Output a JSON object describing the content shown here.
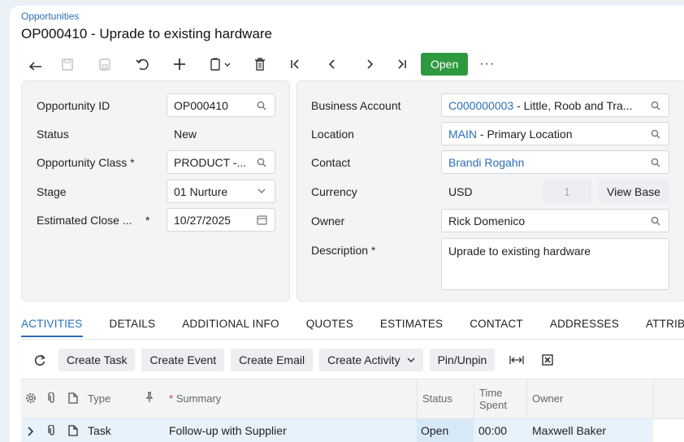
{
  "breadcrumb": "Opportunities",
  "title": "OP000410 - Uprade to existing hardware",
  "toolbar": {
    "icons": [
      "back-arrow-icon",
      "save-icon",
      "save-close-icon",
      "undo-icon",
      "add-icon",
      "copy-icon",
      "delete-icon",
      "first-icon",
      "prev-icon",
      "next-icon",
      "last-icon"
    ],
    "open_label": "Open",
    "more_label": "···"
  },
  "left": {
    "opportunity_id_label": "Opportunity ID",
    "opportunity_id": "OP000410",
    "status_label": "Status",
    "status": "New",
    "class_label": "Opportunity Class",
    "class_value": "PRODUCT -...",
    "stage_label": "Stage",
    "stage_value": "01 Nurture",
    "close_label": "Estimated Close ...",
    "close_value": "10/27/2025",
    "required_mark": "*"
  },
  "right": {
    "business_account_label": "Business Account",
    "business_account_code": "C000000003",
    "business_account_name": " - Little, Roob and Tra...",
    "location_label": "Location",
    "location_code": "MAIN",
    "location_name": " - Primary Location",
    "contact_label": "Contact",
    "contact_value": "Brandi Rogahn",
    "currency_label": "Currency",
    "currency_value": "USD",
    "rate_value": "1",
    "view_base_label": "View Base",
    "owner_label": "Owner",
    "owner_value": "Rick Domenico",
    "description_label": "Description",
    "description_value": "Uprade to existing hardware"
  },
  "tabs": [
    "ACTIVITIES",
    "DETAILS",
    "ADDITIONAL INFO",
    "QUOTES",
    "ESTIMATES",
    "CONTACT",
    "ADDRESSES",
    "ATTRIBU"
  ],
  "activity_bar": {
    "create_task": "Create Task",
    "create_event": "Create Event",
    "create_email": "Create Email",
    "create_activity": "Create Activity",
    "pin_unpin": "Pin/Unpin"
  },
  "grid": {
    "columns": {
      "type": "Type",
      "summary": "Summary",
      "status": "Status",
      "time_spent_1": "Time",
      "time_spent_2": "Spent",
      "owner": "Owner"
    },
    "rows": [
      {
        "type": "Task",
        "summary": "Follow-up with Supplier",
        "status": "Open",
        "time_spent": "00:00",
        "owner": "Maxwell Baker"
      }
    ]
  },
  "colors": {
    "accent": "#2a6fbb",
    "open_button": "#2e9a3f",
    "panel_bg": "#f3f4f6"
  }
}
